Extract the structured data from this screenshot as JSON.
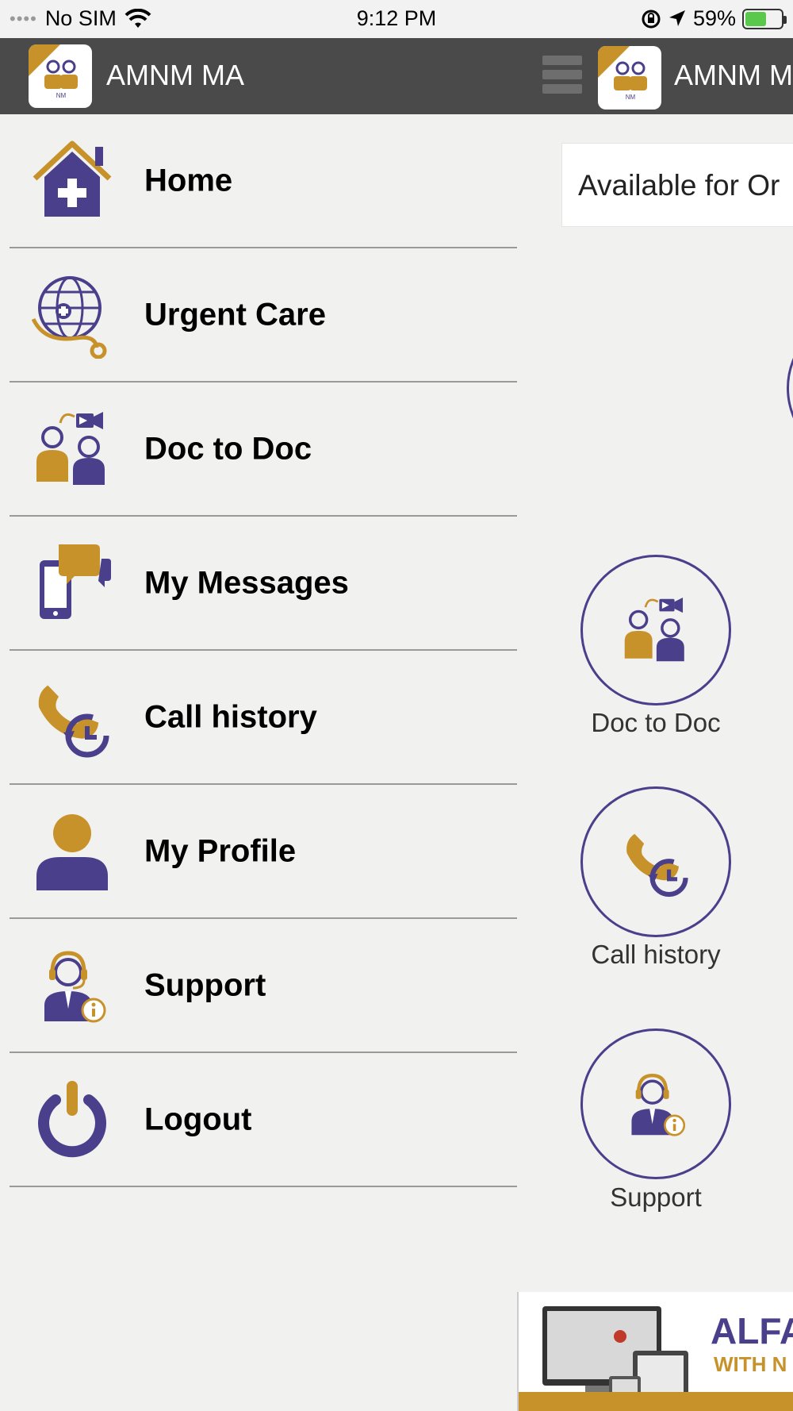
{
  "status_bar": {
    "signal": "No SIM",
    "time": "9:12 PM",
    "battery": "59%",
    "battery_level": 0.59
  },
  "app_bar": {
    "title_left": "AMNM MA",
    "title_right": "AMNM M"
  },
  "drawer": {
    "items": [
      {
        "label": "Home",
        "icon": "home-icon"
      },
      {
        "label": "Urgent Care",
        "icon": "globe-stethoscope-icon"
      },
      {
        "label": "Doc to Doc",
        "icon": "doctors-video-icon"
      },
      {
        "label": "My Messages",
        "icon": "phone-chat-icon"
      },
      {
        "label": "Call history",
        "icon": "call-history-icon"
      },
      {
        "label": "My Profile",
        "icon": "person-icon"
      },
      {
        "label": "Support",
        "icon": "support-agent-icon"
      },
      {
        "label": "Logout",
        "icon": "power-icon"
      }
    ]
  },
  "main": {
    "availability_text": "Available for Or",
    "tiles": [
      {
        "label": "Doc to Doc",
        "icon": "doctors-video-icon"
      },
      {
        "label": "Call history",
        "icon": "call-history-icon"
      },
      {
        "label": "Support",
        "icon": "support-agent-icon"
      }
    ]
  },
  "ad": {
    "title": "ALFA",
    "subtitle": "WITH N"
  },
  "colors": {
    "brand_purple": "#4a3f8a",
    "brand_gold": "#c8922b",
    "app_bar": "#4a4a4a"
  }
}
